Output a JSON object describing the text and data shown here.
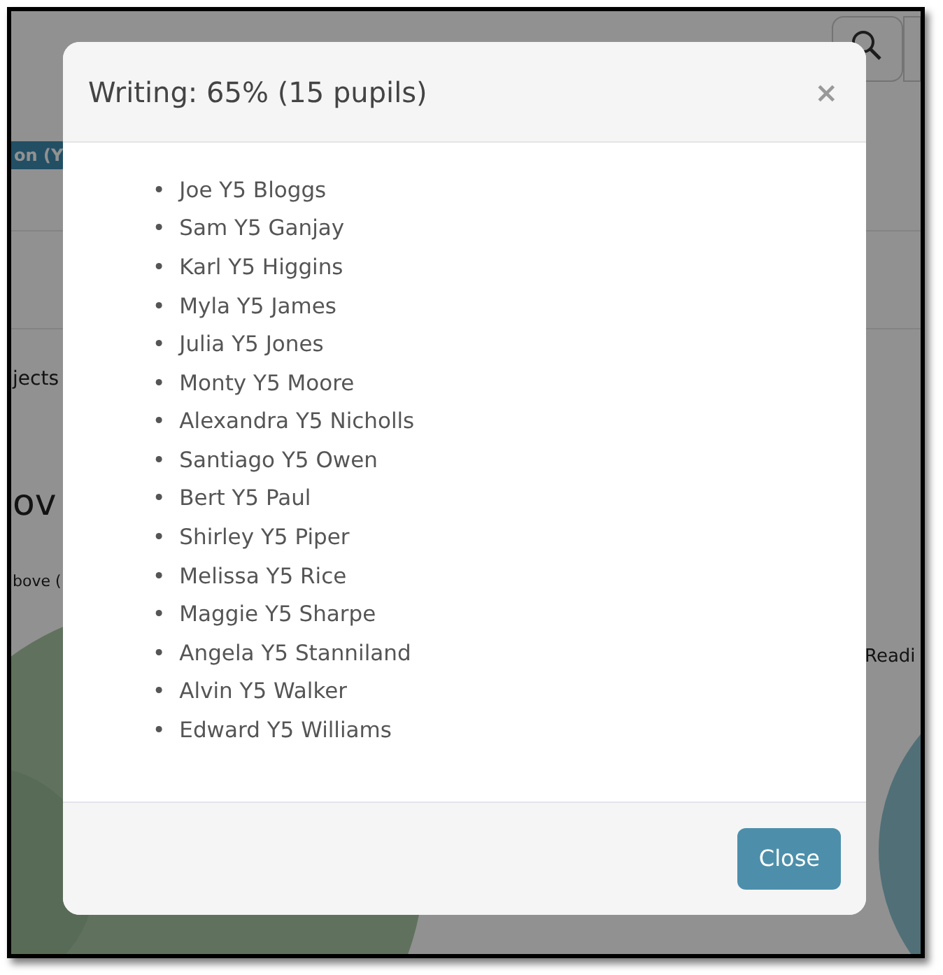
{
  "background": {
    "tab_label": "on (Y",
    "subjects_fragment": "jects",
    "heading_fragment": "ov",
    "legend_fragment": "bove (",
    "chart_label_fragment": "Readi"
  },
  "modal": {
    "title": "Writing: 65% (15 pupils)",
    "close_symbol": "×",
    "pupils": [
      {
        "marker": "•",
        "name": "Joe Y5 Bloggs"
      },
      {
        "marker": "•",
        "name": "Sam Y5 Ganjay"
      },
      {
        "marker": "•",
        "name": "Karl Y5 Higgins"
      },
      {
        "marker": "•",
        "name": "Myla Y5 James"
      },
      {
        "marker": "•",
        "name": "Julia Y5 Jones"
      },
      {
        "marker": "•",
        "name": "Monty Y5 Moore"
      },
      {
        "marker": "•",
        "name": "Alexandra Y5 Nicholls"
      },
      {
        "marker": "•",
        "name": "Santiago Y5 Owen"
      },
      {
        "marker": "•",
        "name": "Bert Y5 Paul"
      },
      {
        "marker": "•",
        "name": "Shirley Y5 Piper"
      },
      {
        "marker": "•",
        "name": "Melissa Y5 Rice"
      },
      {
        "marker": "•",
        "name": "Maggie Y5 Sharpe"
      },
      {
        "marker": "•",
        "name": "Angela Y5 Stanniland"
      },
      {
        "marker": "•",
        "name": "Alvin Y5 Walker"
      },
      {
        "marker": "•",
        "name": "Edward Y5 Williams"
      }
    ],
    "button": "Close"
  }
}
